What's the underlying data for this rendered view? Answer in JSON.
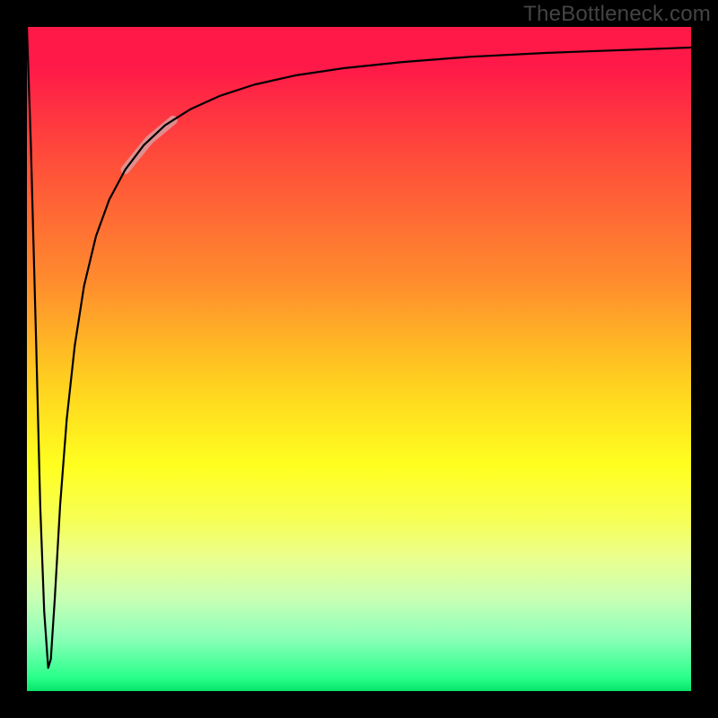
{
  "watermark": "TheBottleneck.com",
  "chart_data": {
    "type": "line",
    "title": "",
    "xlabel": "",
    "ylabel": "",
    "xlim": [
      0,
      100
    ],
    "ylim": [
      0,
      100
    ],
    "grid": false,
    "legend": false,
    "background": "rainbow-vertical",
    "description": "Bottleneck curve: a near-vertical spike down to the optimum near x≈3, then a steep rise flattening toward the top-right with a highlighted segment around x≈15–22.",
    "series": [
      {
        "name": "bottleneck-curve",
        "x": [
          0,
          0.6,
          1.4,
          2.0,
          2.6,
          3.2,
          3.2,
          3.6,
          4.2,
          5.0,
          6.0,
          7.2,
          8.6,
          10.4,
          12.4,
          14.8,
          17.6,
          20.8,
          24.6,
          29.0,
          34.2,
          40.4,
          47.8,
          56.4,
          66.6,
          78.4,
          92.2,
          100.0
        ],
        "y": [
          100,
          82.0,
          52.0,
          28.0,
          12.0,
          3.5,
          3.5,
          4.8,
          14.0,
          28.0,
          41.0,
          52.0,
          61.0,
          68.5,
          74.0,
          78.5,
          82.2,
          85.2,
          87.6,
          89.6,
          91.3,
          92.7,
          93.8,
          94.7,
          95.5,
          96.1,
          96.6,
          96.9
        ]
      }
    ],
    "highlight": {
      "x_start": 14.8,
      "x_end": 22.0
    },
    "colors": {
      "curve": "#000000",
      "highlight": "#d7a3a6",
      "frame": "#000000"
    }
  }
}
